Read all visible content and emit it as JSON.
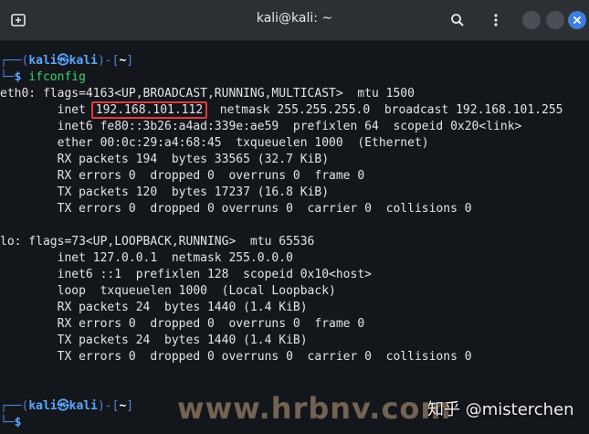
{
  "window": {
    "title": "kali@kali: ~",
    "icons": {
      "new_tab": "new-tab-icon",
      "search": "search-icon",
      "menu": "kebab-menu-icon",
      "minimize": "minimize-icon",
      "maximize": "maximize-icon",
      "close": "close-icon"
    }
  },
  "terminal": {
    "prompt1": {
      "frame_top": "┌──(",
      "user": "kali",
      "at": "㉿",
      "host": "kali",
      "mid": ")-[",
      "dir": "~",
      "end": "]",
      "frame_bottom": "└─",
      "dollar": "$",
      "command": " ifconfig"
    },
    "eth0": {
      "header": "eth0: flags=4163<UP,BROADCAST,RUNNING,MULTICAST>  mtu 1500",
      "inet_prefix": "        inet ",
      "inet_ip": "192.168.101.112",
      "inet_suffix": "  netmask 255.255.255.0  broadcast 192.168.101.255",
      "lines": [
        "        inet6 fe80::3b26:a4ad:339e:ae59  prefixlen 64  scopeid 0x20<link>",
        "        ether 00:0c:29:a4:68:45  txqueuelen 1000  (Ethernet)",
        "        RX packets 194  bytes 33565 (32.7 KiB)",
        "        RX errors 0  dropped 0  overruns 0  frame 0",
        "        TX packets 120  bytes 17237 (16.8 KiB)",
        "        TX errors 0  dropped 0 overruns 0  carrier 0  collisions 0"
      ]
    },
    "lo": {
      "header": "lo: flags=73<UP,LOOPBACK,RUNNING>  mtu 65536",
      "lines": [
        "        inet 127.0.0.1  netmask 255.0.0.0",
        "        inet6 ::1  prefixlen 128  scopeid 0x10<host>",
        "        loop  txqueuelen 1000  (Local Loopback)",
        "        RX packets 24  bytes 1440 (1.4 KiB)",
        "        RX errors 0  dropped 0  overruns 0  frame 0",
        "        TX packets 24  bytes 1440 (1.4 KiB)",
        "        TX errors 0  dropped 0 overruns 0  carrier 0  collisions 0"
      ]
    },
    "prompt2": {
      "frame_top": "┌──(",
      "user": "kali",
      "at": "㉿",
      "host": "kali",
      "mid": ")-[",
      "dir": "~",
      "end": "]",
      "frame_bottom": "└─",
      "dollar": "$"
    }
  },
  "watermarks": {
    "site": "www.hrbnv.com",
    "author": "知乎 @misterchen"
  },
  "colors": {
    "background": "#13161b",
    "titlebar": "#2c2f33",
    "prompt_blue": "#5aa7ff",
    "command_green": "#36d46f",
    "highlight_red": "#e13b3b",
    "close_button": "#3f7ddb"
  }
}
